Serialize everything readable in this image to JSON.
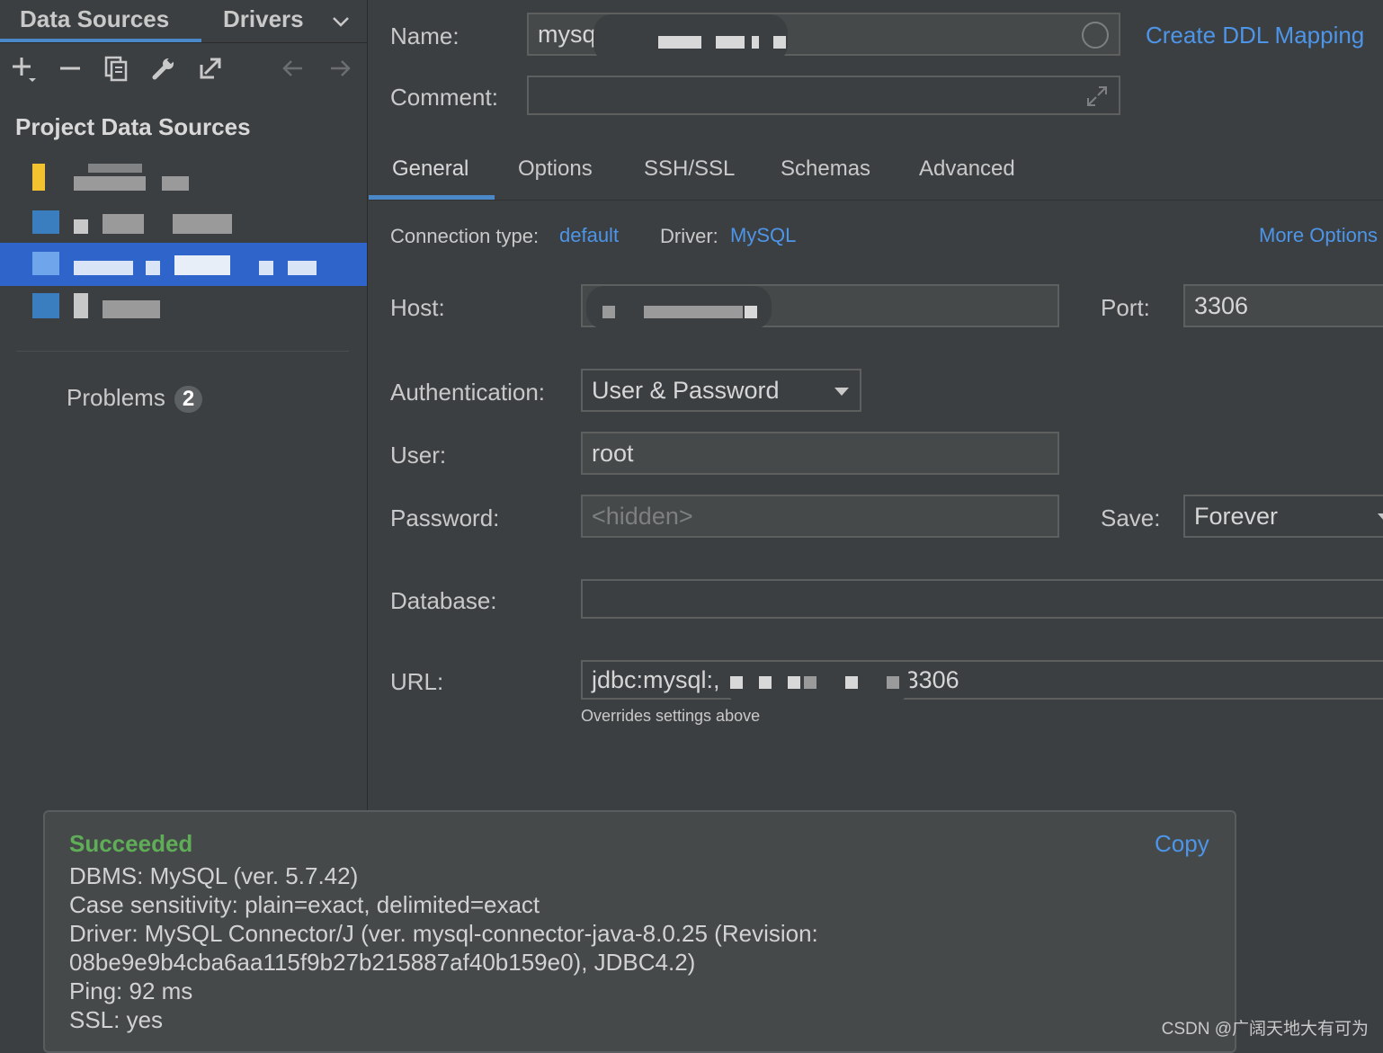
{
  "left": {
    "tabs": [
      "Data Sources",
      "Drivers"
    ],
    "section_title": "Project Data Sources",
    "problems_label": "Problems",
    "problems_count": "2"
  },
  "form": {
    "name_label": "Name:",
    "name_value": "mysq",
    "create_ddl_link": "Create DDL Mapping",
    "comment_label": "Comment:",
    "tabs": [
      "General",
      "Options",
      "SSH/SSL",
      "Schemas",
      "Advanced"
    ],
    "active_tab": "General",
    "connection_type_label": "Connection type:",
    "connection_type_value": "default",
    "driver_label": "Driver:",
    "driver_value": "MySQL",
    "more_options_link": "More Options",
    "host_label": "Host:",
    "port_label": "Port:",
    "port_value": "3306",
    "auth_label": "Authentication:",
    "auth_value": "User & Password",
    "user_label": "User:",
    "user_value": "root",
    "password_label": "Password:",
    "password_placeholder": "<hidden>",
    "save_label": "Save:",
    "save_value": "Forever",
    "database_label": "Database:",
    "url_label": "URL:",
    "url_prefix": "jdbc:mysql:,",
    "url_suffix": "3306",
    "url_hint": "Overrides settings above"
  },
  "popup": {
    "title": "Succeeded",
    "copy_label": "Copy",
    "lines": [
      "DBMS: MySQL (ver. 5.7.42)",
      "Case sensitivity: plain=exact, delimited=exact",
      "Driver: MySQL Connector/J (ver. mysql-connector-java-8.0.25 (Revision:",
      "08be9e9b4cba6aa115f9b27b215887af40b159e0), JDBC4.2)",
      "Ping: 92 ms",
      "SSL: yes"
    ]
  },
  "watermark": "CSDN @广阔天地大有可为",
  "colors": {
    "background": "#3c3f41",
    "accent": "#4a88c7",
    "link": "#4d95e8",
    "selection": "#2f65ca",
    "success": "#5fae57"
  }
}
